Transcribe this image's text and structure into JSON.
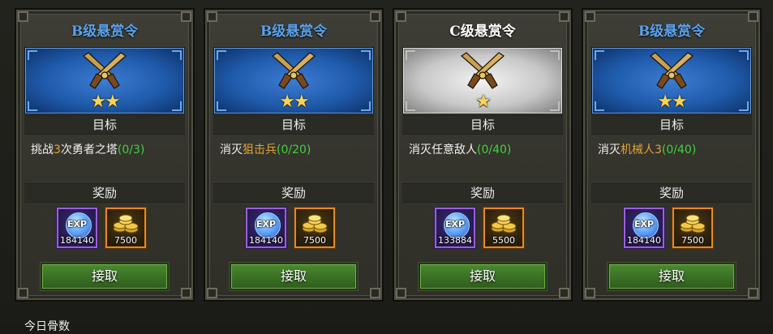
{
  "cards": [
    {
      "title": "B级悬赏令",
      "tier": "B",
      "stars": "★★",
      "goal_header": "目标",
      "goal_prefix": "挑战",
      "goal_highlight": "3",
      "goal_suffix": "次勇者之塔",
      "goal_progress": "(0/3)",
      "reward_header": "奖励",
      "exp_label": "EXP",
      "exp_value": "184140",
      "gold_value": "7500",
      "button": "接取"
    },
    {
      "title": "B级悬赏令",
      "tier": "B",
      "stars": "★★",
      "goal_header": "目标",
      "goal_prefix": "消灭",
      "goal_highlight": "狙击兵",
      "goal_suffix": "",
      "goal_progress": "(0/20)",
      "reward_header": "奖励",
      "exp_label": "EXP",
      "exp_value": "184140",
      "gold_value": "7500",
      "button": "接取"
    },
    {
      "title": "C级悬赏令",
      "tier": "C",
      "stars": "★",
      "goal_header": "目标",
      "goal_prefix": "消灭任意敌人",
      "goal_highlight": "",
      "goal_suffix": "",
      "goal_progress": "(0/40)",
      "reward_header": "奖励",
      "exp_label": "EXP",
      "exp_value": "133884",
      "gold_value": "5500",
      "button": "接取"
    },
    {
      "title": "B级悬赏令",
      "tier": "B",
      "stars": "★★",
      "goal_header": "目标",
      "goal_prefix": "消灭",
      "goal_highlight": "机械人3",
      "goal_suffix": "",
      "goal_progress": "(0/40)",
      "reward_header": "奖励",
      "exp_label": "EXP",
      "exp_value": "184140",
      "gold_value": "7500",
      "button": "接取"
    }
  ],
  "footer": {
    "label": "今日骨数"
  },
  "colors": {
    "title_b": "#5aa2ee",
    "title_c": "#ffffff",
    "highlight": "#e0a43a",
    "progress": "#3fd23f",
    "button": "#3c7426"
  },
  "icons": {
    "emblem": "crossed-pistols-icon",
    "exp": "exp-orb-icon",
    "gold": "gold-coins-icon"
  }
}
